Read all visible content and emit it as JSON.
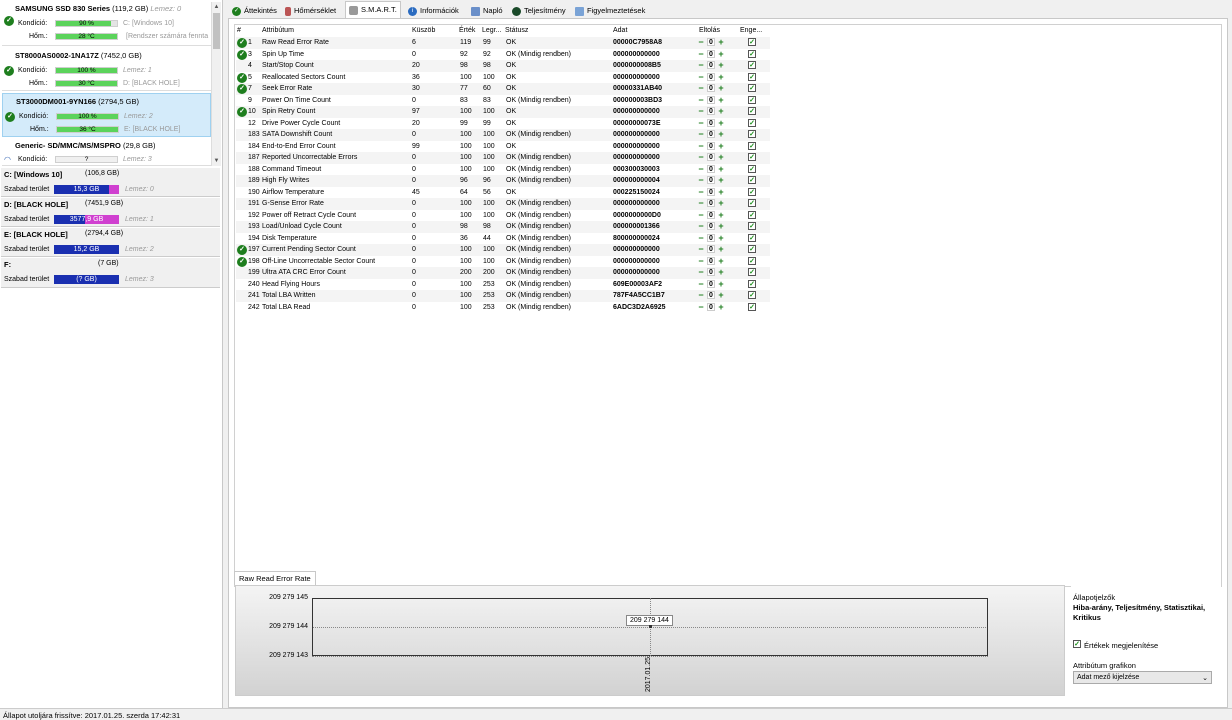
{
  "disks": [
    {
      "name": "SAMSUNG SSD 830 Series",
      "size": "(119,2 GB)",
      "disk_label": "Lemez: 0",
      "health_label": "Kondíció:",
      "health": "90 %",
      "health_pct": 0.9,
      "health_aux": "C: [Windows 10]",
      "temp_label": "Hőm.:",
      "temp": "28 °C",
      "temp_aux": "[Rendszer számára fennta"
    },
    {
      "name": "ST8000AS0002-1NA17Z",
      "size": "(7452,0 GB)",
      "health_label": "Kondíció:",
      "health": "100 %",
      "health_pct": 1.0,
      "health_aux": "Lemez: 1",
      "temp_label": "Hőm.:",
      "temp": "30 °C",
      "temp_aux": "D: [BLACK HOLE]"
    },
    {
      "name": "ST3000DM001-9YN166",
      "size": "(2794,5 GB)",
      "health_label": "Kondíció:",
      "health": "100 %",
      "health_pct": 1.0,
      "health_aux": "Lemez: 2",
      "temp_label": "Hőm.:",
      "temp": "36 °C",
      "temp_aux": "E: [BLACK HOLE]"
    },
    {
      "name": "Generic- SD/MMC/MS/MSPRO",
      "size": "(29,8 GB)",
      "health_label": "Kondíció:",
      "health": "?",
      "health_aux": "Lemez: 3"
    }
  ],
  "partitions": [
    {
      "name": "C: [Windows 10]",
      "size": "(106,8 GB)",
      "free_label": "Szabad terület",
      "free": "15,3 GB",
      "aux": "Lemez: 0"
    },
    {
      "name": "D: [BLACK HOLE]",
      "size": "(7451,9 GB)",
      "free_label": "Szabad terület",
      "free": "3577,9 GB",
      "aux": "Lemez: 1"
    },
    {
      "name": "E: [BLACK HOLE]",
      "size": "(2794,4 GB)",
      "free_label": "Szabad terület",
      "free": "15,2 GB",
      "aux": "Lemez: 2"
    },
    {
      "name": "F:",
      "size": "(7 GB)",
      "free_label": "Szabad terület",
      "free": "(? GB)",
      "aux": "Lemez: 3"
    }
  ],
  "status_bar": "Állapot utoljára frissítve: 2017.01.25. szerda 17:42:31",
  "tabs": [
    {
      "label": "Áttekintés",
      "icon": "check-icon"
    },
    {
      "label": "Hőmérséklet",
      "icon": "thermometer-icon"
    },
    {
      "label": "S.M.A.R.T.",
      "icon": "smart-icon"
    },
    {
      "label": "Információk",
      "icon": "info-icon"
    },
    {
      "label": "Napló",
      "icon": "log-icon"
    },
    {
      "label": "Teljesítmény",
      "icon": "performance-icon"
    },
    {
      "label": "Figyelmeztetések",
      "icon": "alerts-icon"
    }
  ],
  "columns": {
    "num": "#",
    "attr": "Attribútum",
    "thresh": "Küszöb",
    "value": "Érték",
    "worst": "Legr...",
    "status": "Státusz",
    "data": "Adat",
    "offset": "Eltolás",
    "enable": "Enge..."
  },
  "rows": [
    {
      "ok": true,
      "num": "1",
      "attr": "Raw Read Error Rate",
      "thresh": "6",
      "value": "119",
      "worst": "99",
      "status": "OK",
      "data": "00000C7958A8"
    },
    {
      "ok": true,
      "num": "3",
      "attr": "Spin Up Time",
      "thresh": "0",
      "value": "92",
      "worst": "92",
      "status": "OK (Mindig rendben)",
      "data": "000000000000"
    },
    {
      "ok": false,
      "num": "4",
      "attr": "Start/Stop Count",
      "thresh": "20",
      "value": "98",
      "worst": "98",
      "status": "OK",
      "data": "0000000008B5"
    },
    {
      "ok": true,
      "num": "5",
      "attr": "Reallocated Sectors Count",
      "thresh": "36",
      "value": "100",
      "worst": "100",
      "status": "OK",
      "data": "000000000000"
    },
    {
      "ok": true,
      "num": "7",
      "attr": "Seek Error Rate",
      "thresh": "30",
      "value": "77",
      "worst": "60",
      "status": "OK",
      "data": "00000331AB40"
    },
    {
      "ok": false,
      "num": "9",
      "attr": "Power On Time Count",
      "thresh": "0",
      "value": "83",
      "worst": "83",
      "status": "OK (Mindig rendben)",
      "data": "000000003BD3"
    },
    {
      "ok": true,
      "num": "10",
      "attr": "Spin Retry Count",
      "thresh": "97",
      "value": "100",
      "worst": "100",
      "status": "OK",
      "data": "000000000000"
    },
    {
      "ok": false,
      "num": "12",
      "attr": "Drive Power Cycle Count",
      "thresh": "20",
      "value": "99",
      "worst": "99",
      "status": "OK",
      "data": "00000000073E"
    },
    {
      "ok": false,
      "num": "183",
      "attr": "SATA Downshift Count",
      "thresh": "0",
      "value": "100",
      "worst": "100",
      "status": "OK (Mindig rendben)",
      "data": "000000000000"
    },
    {
      "ok": false,
      "num": "184",
      "attr": "End-to-End Error Count",
      "thresh": "99",
      "value": "100",
      "worst": "100",
      "status": "OK",
      "data": "000000000000"
    },
    {
      "ok": false,
      "num": "187",
      "attr": "Reported Uncorrectable Errors",
      "thresh": "0",
      "value": "100",
      "worst": "100",
      "status": "OK (Mindig rendben)",
      "data": "000000000000"
    },
    {
      "ok": false,
      "num": "188",
      "attr": "Command Timeout",
      "thresh": "0",
      "value": "100",
      "worst": "100",
      "status": "OK (Mindig rendben)",
      "data": "000300030003"
    },
    {
      "ok": false,
      "num": "189",
      "attr": "High Fly Writes",
      "thresh": "0",
      "value": "96",
      "worst": "96",
      "status": "OK (Mindig rendben)",
      "data": "000000000004"
    },
    {
      "ok": false,
      "num": "190",
      "attr": "Airflow Temperature",
      "thresh": "45",
      "value": "64",
      "worst": "56",
      "status": "OK",
      "data": "000225150024"
    },
    {
      "ok": false,
      "num": "191",
      "attr": "G-Sense Error Rate",
      "thresh": "0",
      "value": "100",
      "worst": "100",
      "status": "OK (Mindig rendben)",
      "data": "000000000000"
    },
    {
      "ok": false,
      "num": "192",
      "attr": "Power off Retract Cycle Count",
      "thresh": "0",
      "value": "100",
      "worst": "100",
      "status": "OK (Mindig rendben)",
      "data": "0000000000D0"
    },
    {
      "ok": false,
      "num": "193",
      "attr": "Load/Unload Cycle Count",
      "thresh": "0",
      "value": "98",
      "worst": "98",
      "status": "OK (Mindig rendben)",
      "data": "000000001366"
    },
    {
      "ok": false,
      "num": "194",
      "attr": "Disk Temperature",
      "thresh": "0",
      "value": "36",
      "worst": "44",
      "status": "OK (Mindig rendben)",
      "data": "800000000024"
    },
    {
      "ok": true,
      "num": "197",
      "attr": "Current Pending Sector Count",
      "thresh": "0",
      "value": "100",
      "worst": "100",
      "status": "OK (Mindig rendben)",
      "data": "000000000000"
    },
    {
      "ok": true,
      "num": "198",
      "attr": "Off-Line Uncorrectable Sector Count",
      "thresh": "0",
      "value": "100",
      "worst": "100",
      "status": "OK (Mindig rendben)",
      "data": "000000000000"
    },
    {
      "ok": false,
      "num": "199",
      "attr": "Ultra ATA CRC Error Count",
      "thresh": "0",
      "value": "200",
      "worst": "200",
      "status": "OK (Mindig rendben)",
      "data": "000000000000"
    },
    {
      "ok": false,
      "num": "240",
      "attr": "Head Flying Hours",
      "thresh": "0",
      "value": "100",
      "worst": "253",
      "status": "OK (Mindig rendben)",
      "data": "609E00003AF2"
    },
    {
      "ok": false,
      "num": "241",
      "attr": "Total LBA Written",
      "thresh": "0",
      "value": "100",
      "worst": "253",
      "status": "OK (Mindig rendben)",
      "data": "787F4A5CC1B7"
    },
    {
      "ok": false,
      "num": "242",
      "attr": "Total LBA Read",
      "thresh": "0",
      "value": "100",
      "worst": "253",
      "status": "OK (Mindig rendben)",
      "data": "6ADC3D2A6925"
    }
  ],
  "offset_value": "0",
  "graph": {
    "tab": "Raw Read Error Rate",
    "y_ticks": [
      "209 279 145",
      "209 279 144",
      "209 279 143"
    ],
    "point_label": "209 279 144",
    "date": "2017.01.25."
  },
  "side": {
    "indicators_title": "Állapotjelzők",
    "indicators": "Hiba-arány, Teljesítmény, Statisztikai, Kritikus",
    "show_values": "Értékek megjelenítése",
    "graph_label": "Attribútum grafikon",
    "graph_select": "Adat mező kijelzése"
  }
}
